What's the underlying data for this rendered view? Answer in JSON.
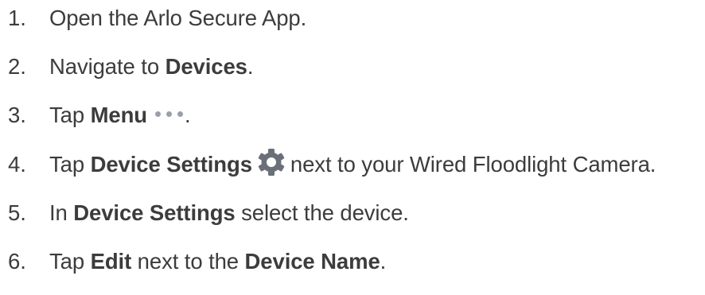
{
  "steps": [
    {
      "number": "1.",
      "parts": [
        "Open the Arlo Secure App."
      ]
    },
    {
      "number": "2.",
      "parts": [
        "Navigate to ",
        "Devices",
        "."
      ]
    },
    {
      "number": "3.",
      "parts": [
        "Tap ",
        "Menu",
        "."
      ]
    },
    {
      "number": "4.",
      "parts": [
        "Tap ",
        "Device Settings",
        "next to your Wired Floodlight Camera."
      ]
    },
    {
      "number": "5.",
      "parts": [
        "In ",
        "Device Settings",
        " select the device."
      ]
    },
    {
      "number": "6.",
      "parts": [
        "Tap ",
        "Edit",
        " next to the ",
        "Device Name",
        "."
      ]
    }
  ],
  "icons": {
    "menu": "more-horizontal-dots-icon",
    "settings": "gear-icon"
  },
  "colors": {
    "text": "#3c3c3c",
    "icon_gray": "#6b7078",
    "dots_gray": "#9aa0aa"
  }
}
